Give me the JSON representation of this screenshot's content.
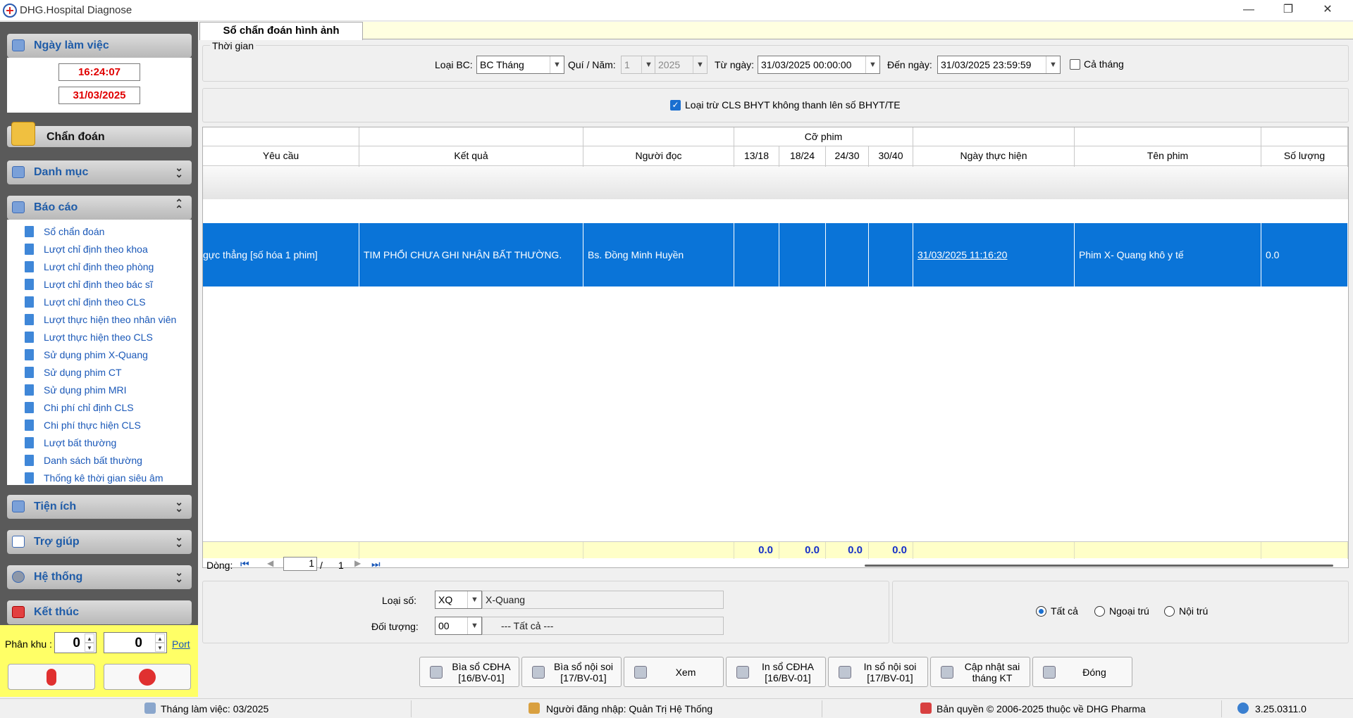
{
  "window": {
    "title": "DHG.Hospital Diagnose",
    "minimize": "—",
    "restore": "❐",
    "close": "✕"
  },
  "sidebar": {
    "workday_title": "Ngày làm việc",
    "time": "16:24:07",
    "date": "31/03/2025",
    "chan_doan": "Chẩn đoán",
    "danh_muc": "Danh mục",
    "bao_cao": "Báo cáo",
    "report_items": [
      "Sổ chẩn đoán",
      "Lượt chỉ định theo khoa",
      "Lượt chỉ định theo phòng",
      "Lượt chỉ định theo bác sĩ",
      "Lượt chỉ định theo CLS",
      "Lượt thực hiện theo nhân viên",
      "Lượt thực hiện theo CLS",
      "Sử dụng phim X-Quang",
      "Sử dụng phim CT",
      "Sử dụng phim MRI",
      "Chi phí chỉ định CLS",
      "Chi phí thực hiện CLS",
      "Lượt bất thường",
      "Danh sách bất thường",
      "Thống kê thời gian siêu âm"
    ],
    "tien_ich": "Tiện ích",
    "tro_giup": "Trợ giúp",
    "he_thong": "Hệ thống",
    "ket_thuc": "Kết thúc",
    "phan_khu_label": "Phân khu :",
    "phan_khu_value": "0",
    "port_value": "0",
    "port_label": "Port"
  },
  "tab": {
    "label": "Sổ chẩn đoán hình ảnh"
  },
  "filters": {
    "group_label": "Thời gian",
    "loai_bc_label": "Loại BC:",
    "loai_bc_value": "BC Tháng",
    "qui_nam_label": "Quí / Năm:",
    "qui_value": "1",
    "nam_value": "2025",
    "tu_ngay_label": "Từ ngày:",
    "tu_ngay_value": "31/03/2025 00:00:00",
    "den_ngay_label": "Đến ngày:",
    "den_ngay_value": "31/03/2025 23:59:59",
    "ca_thang_label": "Cả tháng",
    "ca_thang_checked": false,
    "loai_tru_label": "Loại trừ CLS BHYT không thanh lên số BHYT/TE",
    "loai_tru_checked": true
  },
  "grid": {
    "group_header": "Cỡ phim",
    "columns": [
      "Yêu cầu",
      "Kết quả",
      "Người đọc",
      "13/18",
      "18/24",
      "24/30",
      "30/40",
      "Ngày thực hiện",
      "Tên phim",
      "Số lượng"
    ],
    "rows": [
      {
        "yeu_cau": "gực thẳng [số hóa 1 phim]",
        "ket_qua": "TIM PHỔI CHƯA GHI NHẬN BẤT THƯỜNG.",
        "nguoi_doc": "Bs. Đồng Minh Huyền",
        "c1318": "",
        "c1824": "",
        "c2430": "",
        "c3040": "",
        "ngay": "31/03/2025 11:16:20",
        "ten_phim": "Phim X- Quang khô y tế",
        "so_luong": "0.0"
      }
    ],
    "totals": [
      "0.0",
      "0.0",
      "0.0",
      "0.0"
    ]
  },
  "nav": {
    "label": "Dòng:",
    "page": "1",
    "sep": "/",
    "total": "1"
  },
  "bottom": {
    "loai_so_label": "Loại số:",
    "loai_so_code": "XQ",
    "loai_so_name": "X-Quang",
    "doi_tuong_label": "Đối tượng:",
    "doi_tuong_code": "00",
    "doi_tuong_name": "--- Tất cả ---",
    "radio_all": "Tất cả",
    "radio_ngoai": "Ngoại trú",
    "radio_noi": "Nội trú"
  },
  "buttons": [
    {
      "l1": "Bìa sổ CĐHA",
      "l2": "[16/BV-01]"
    },
    {
      "l1": "Bìa sổ nội soi",
      "l2": "[17/BV-01]"
    },
    {
      "l1": "Xem",
      "l2": ""
    },
    {
      "l1": "In sổ CĐHA",
      "l2": "[16/BV-01]"
    },
    {
      "l1": "In sổ nội soi",
      "l2": "[17/BV-01]"
    },
    {
      "l1": "Cập nhật sai",
      "l2": "tháng KT"
    },
    {
      "l1": "Đóng",
      "l2": ""
    }
  ],
  "status": {
    "thang": "Tháng làm việc: 03/2025",
    "user": "Người đăng nhập: Quản Trị Hệ Thống",
    "copyright": "Bản quyền © 2006-2025 thuộc về DHG Pharma",
    "version": "3.25.0311.0"
  }
}
